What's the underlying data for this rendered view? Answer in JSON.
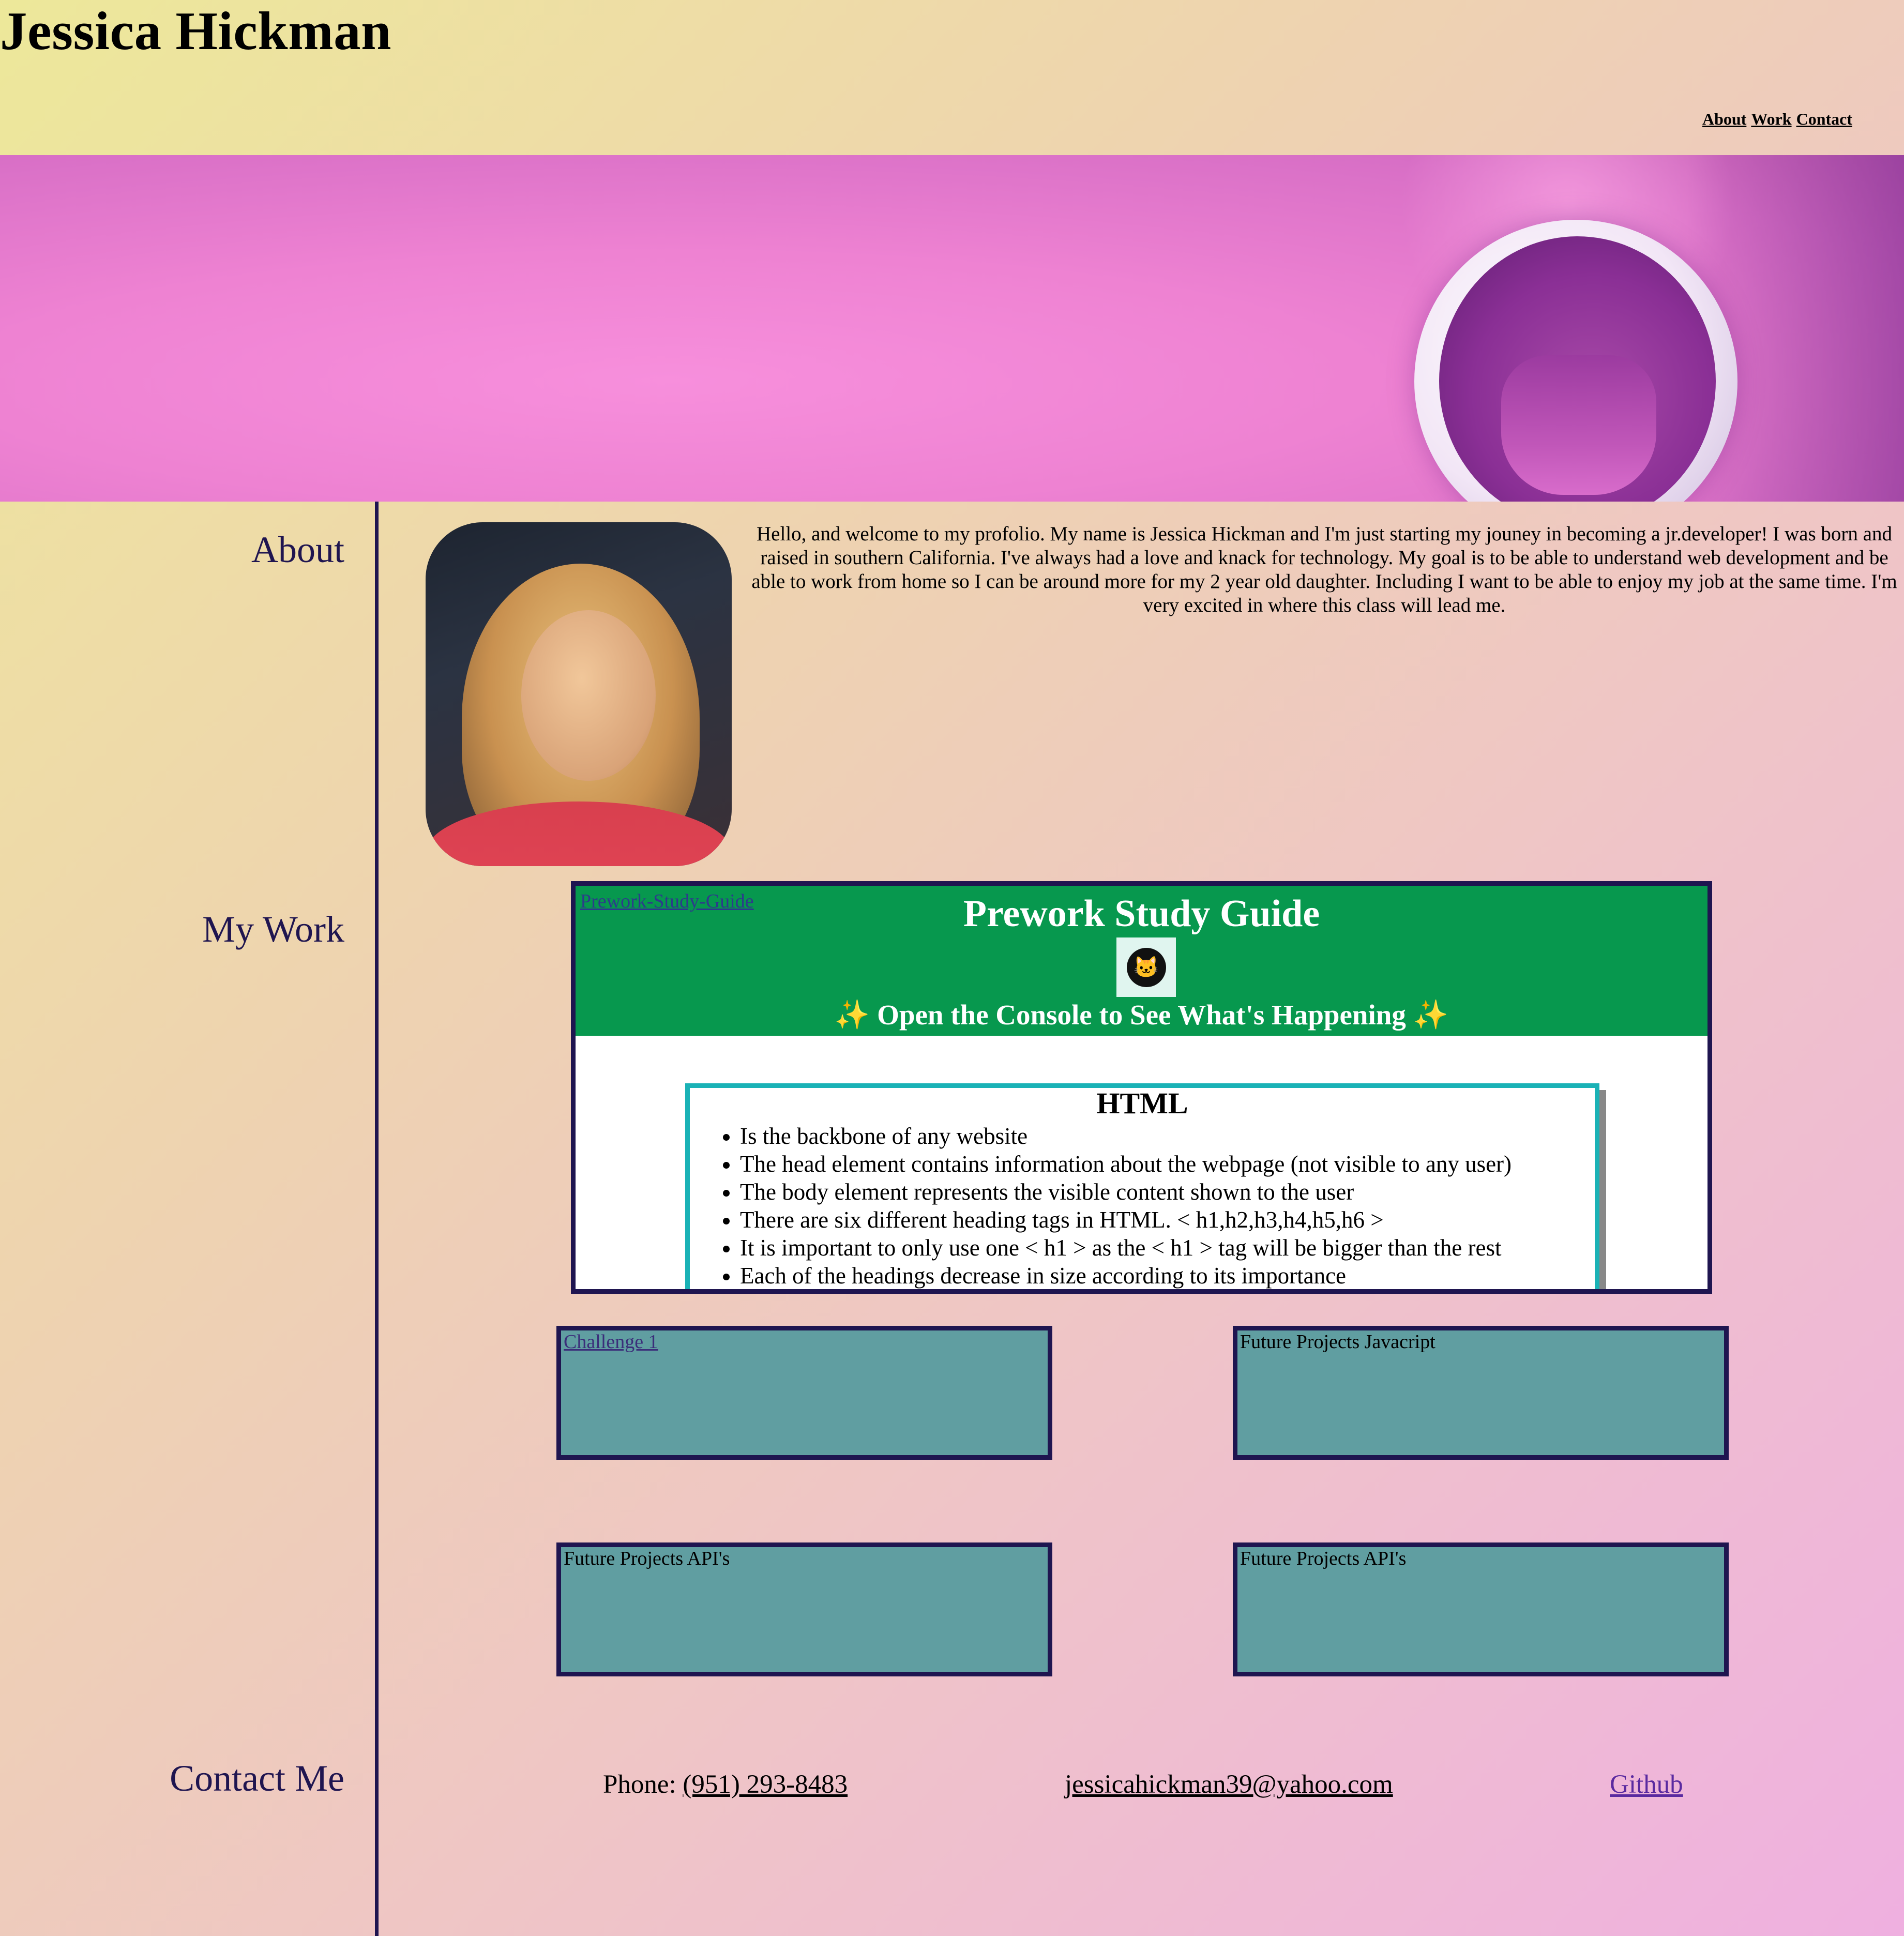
{
  "site_title": "Jessica Hickman",
  "nav": {
    "about": "About",
    "work": "Work",
    "contact": "Contact"
  },
  "sections": {
    "about": "About",
    "work": "My Work",
    "contact": "Contact Me"
  },
  "about_text": "Hello, and welcome to my profolio. My name is Jessica Hickman and I'm just starting my jouney in becoming a jr.developer! I was born and raised in southern California. I've always had a love and knack for technology. My goal is to be able to understand web development and be able to work from home so I can be around more for my 2 year old daughter. Including I want to be able to enjoy my job at the same time. I'm very excited in where this class will lead me.",
  "guide": {
    "link": "Prework-Study-Guide",
    "title": "Prework Study Guide",
    "sparkle": "✨",
    "subtitle": "Open the Console to See What's Happening",
    "logo_icon": "cat-icon",
    "card_title": "HTML",
    "items": [
      "Is the backbone of any website",
      "The head element contains information about the webpage (not visible to any user)",
      "The body element represents the visible content shown to the user",
      "There are six different heading tags in HTML. < h1,h2,h3,h4,h5,h6 >",
      "It is important to only use one < h1 > as the < h1 > tag will be bigger than the rest",
      "Each of the headings decrease in size according to its importance"
    ]
  },
  "projects": [
    {
      "label": "Challenge 1"
    },
    {
      "label": "Future Projects Javacript"
    },
    {
      "label": "Future Projects API's"
    },
    {
      "label": "Future Projects API's"
    }
  ],
  "contact": {
    "phone_label": "Phone: ",
    "phone": "(951) 293-8483",
    "email": "jessicahickman39@yahoo.com",
    "github": "Github"
  },
  "colors": {
    "accent": "#1f1550",
    "project_bg": "#609ea1",
    "guide_green": "#07984e",
    "card_border": "#1ab2b6"
  }
}
